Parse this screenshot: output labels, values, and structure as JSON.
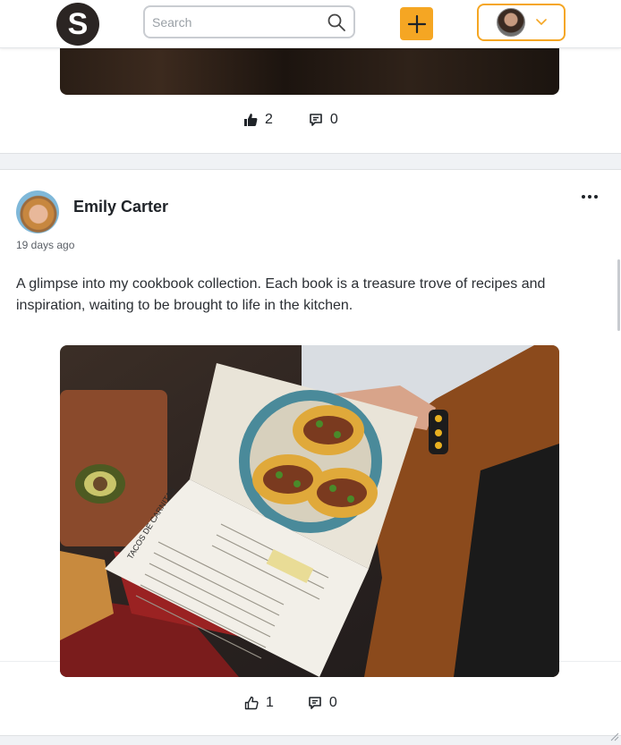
{
  "header": {
    "logo_letter": "S",
    "search": {
      "placeholder": "Search"
    },
    "icons": {
      "search": "search-icon",
      "add": "plus-icon",
      "menu": "chevron-down-icon"
    }
  },
  "previous_post": {
    "likes": "2",
    "comments": "0"
  },
  "post": {
    "author": "Emily Carter",
    "time": "19 days ago",
    "text": "A glimpse into my cookbook collection. Each book is a treasure trove of recipes and inspiration, waiting to be brought to life in the kitchen.",
    "image_label": "TACOS DE CARNITAS",
    "likes": "1",
    "comments": "0"
  },
  "colors": {
    "accent": "#f5a623",
    "logo_bg": "#2b2523"
  }
}
